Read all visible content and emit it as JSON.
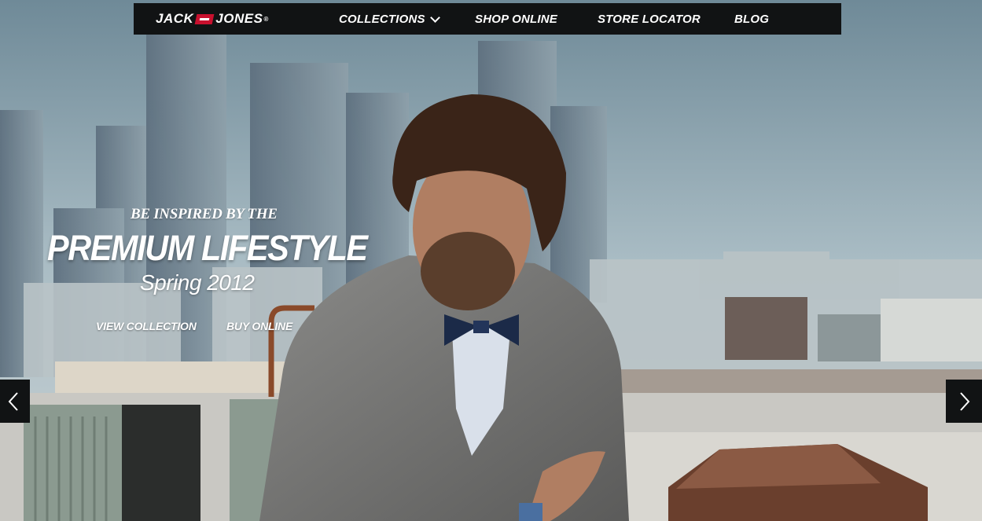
{
  "brand": {
    "logo_left": "JACK",
    "logo_right": "JONES",
    "registered": "®"
  },
  "nav": {
    "collections": "COLLECTIONS",
    "shop_online": "SHOP ONLINE",
    "store_locator": "STORE LOCATOR",
    "blog": "BLOG"
  },
  "hero": {
    "tagline": "BE INSPIRED BY THE",
    "headline": "PREMIUM LIFESTYLE",
    "season": "Spring 2012",
    "view_collection": "VIEW COLLECTION",
    "buy_online": "BUY ONLINE"
  },
  "icons": {
    "prev": "chevron-left-icon",
    "next": "chevron-right-icon",
    "dropdown": "chevron-down-icon"
  },
  "colors": {
    "nav_bg": "#111314",
    "brand_red": "#c8102e",
    "text": "#ffffff"
  }
}
